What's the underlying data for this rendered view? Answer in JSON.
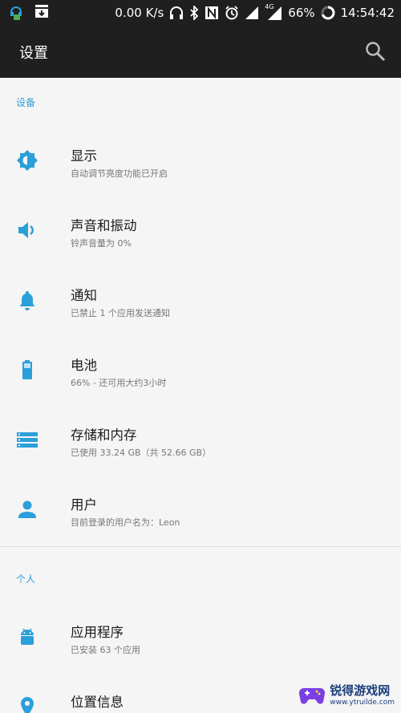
{
  "statusbar": {
    "net_speed": "0.00 K/s",
    "network_type": "4G",
    "battery": "66%",
    "time": "14:54:42"
  },
  "appbar": {
    "title": "设置"
  },
  "sections": {
    "device": "设备",
    "personal": "个人"
  },
  "items": [
    {
      "title": "显示",
      "subtitle": "自动调节亮度功能已开启",
      "icon": "brightness-icon"
    },
    {
      "title": "声音和振动",
      "subtitle": "铃声音量为 0%",
      "icon": "volume-icon"
    },
    {
      "title": "通知",
      "subtitle": "已禁止 1 个应用发送通知",
      "icon": "bell-icon"
    },
    {
      "title": "电池",
      "subtitle": "66% - 还可用大约3小时",
      "icon": "battery-icon"
    },
    {
      "title": "存储和内存",
      "subtitle": "已使用 33.24 GB（共 52.66 GB）",
      "icon": "storage-icon"
    },
    {
      "title": "用户",
      "subtitle": "目前登录的用户名为：Leon",
      "icon": "user-icon"
    },
    {
      "title": "应用程序",
      "subtitle": "已安装 63 个应用",
      "icon": "android-icon"
    },
    {
      "title": "位置信息",
      "subtitle": "",
      "icon": "location-icon"
    }
  ],
  "watermark": {
    "title": "锐得游戏网",
    "url": "www.ytruilde.com"
  },
  "colors": {
    "accent": "#2b9fd9",
    "toolbar": "#1f1f1f",
    "background": "#f5f5f5"
  }
}
